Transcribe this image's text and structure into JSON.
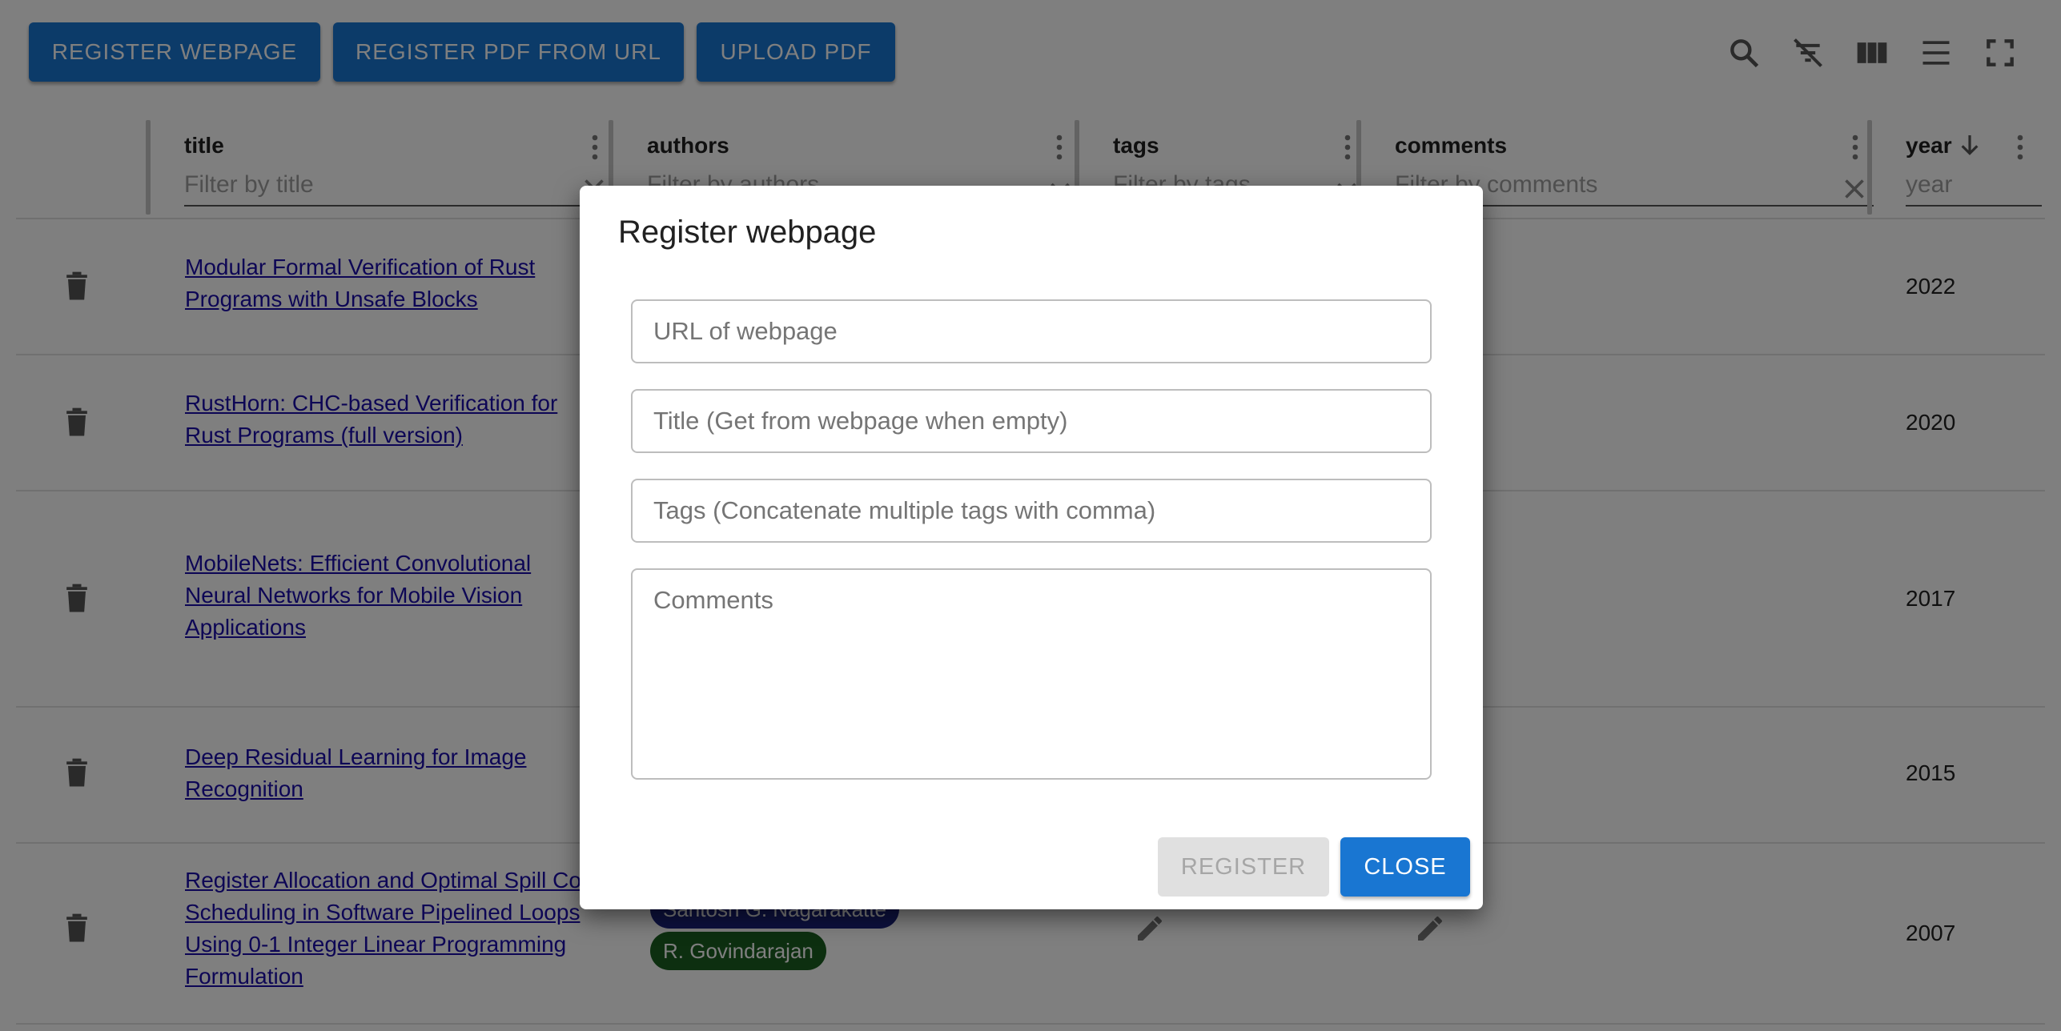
{
  "toolbar": {
    "register_webpage": "REGISTER WEBPAGE",
    "register_pdf_url": "REGISTER PDF FROM URL",
    "upload_pdf": "UPLOAD PDF",
    "icons": [
      "search-icon",
      "filter-off-icon",
      "columns-icon",
      "density-icon",
      "fullscreen-icon"
    ]
  },
  "table": {
    "columns": [
      {
        "name": "title",
        "filter_placeholder": "Filter by title"
      },
      {
        "name": "authors",
        "filter_placeholder": "Filter by authors"
      },
      {
        "name": "tags",
        "filter_placeholder": "Filter by tags"
      },
      {
        "name": "comments",
        "filter_placeholder": "Filter by comments"
      },
      {
        "name": "year",
        "filter_placeholder": "year",
        "sort": "descending"
      }
    ],
    "rows": [
      {
        "title": "Modular Formal Verification of Rust Programs with Unsafe Blocks",
        "year": "2022"
      },
      {
        "title": "RustHorn: CHC-based Verification for Rust Programs (full version)",
        "year": "2020"
      },
      {
        "title": "MobileNets: Efficient Convolutional Neural Networks for Mobile Vision Applications",
        "year": "2017"
      },
      {
        "title": "Deep Residual Learning for Image Recognition",
        "year": "2015"
      },
      {
        "title": "Register Allocation and Optimal Spill Code Scheduling in Software Pipelined Loops Using 0-1 Integer Linear Programming Formulation",
        "year": "2007",
        "authors": [
          "Santosh G. Nagarakatte",
          "R. Govindarajan"
        ]
      }
    ],
    "colors": {
      "link": "#1a0dab",
      "chip_blue": "#1a237e",
      "chip_green": "#1b5e20"
    }
  },
  "dialog": {
    "title": "Register webpage",
    "url_placeholder": "URL of webpage",
    "title_placeholder": "Title (Get from webpage when empty)",
    "tags_placeholder": "Tags (Concatenate multiple tags with comma)",
    "comments_placeholder": "Comments",
    "register_label": "REGISTER",
    "close_label": "CLOSE"
  },
  "colors": {
    "primary": "#1976d2",
    "backdrop": "rgba(0,0,0,0.5)"
  }
}
